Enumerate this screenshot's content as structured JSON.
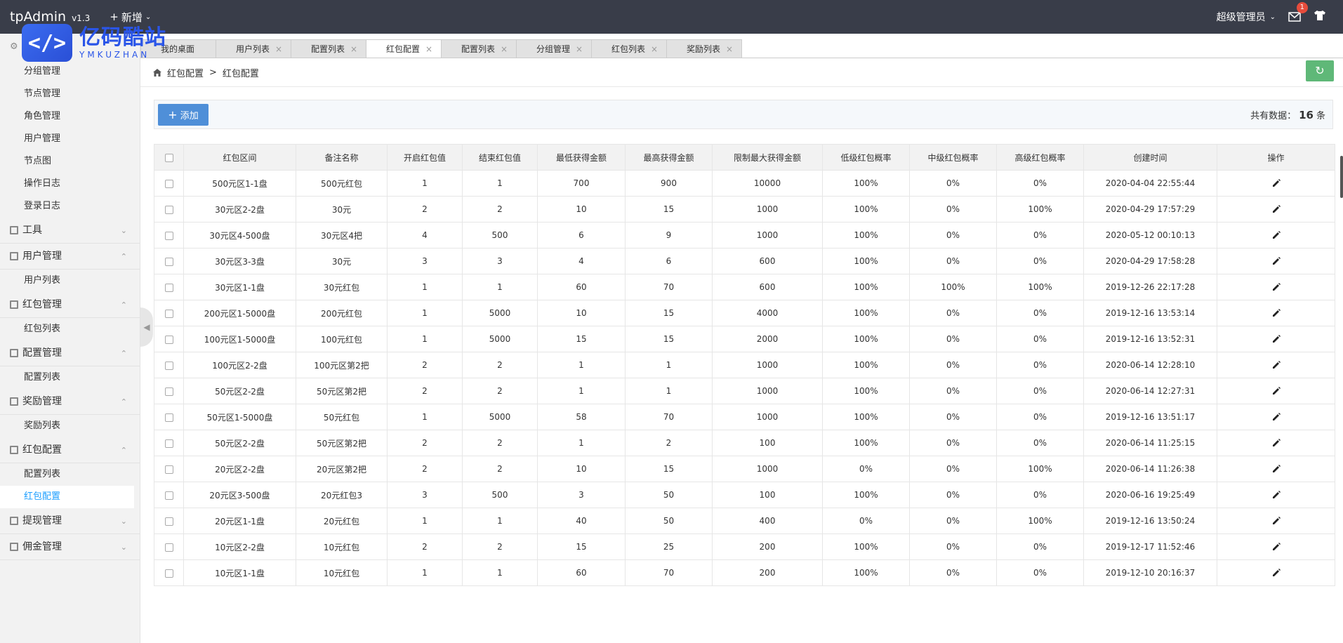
{
  "app": {
    "title": "tpAdmin",
    "version": "v1.3",
    "add_label": "新增"
  },
  "header": {
    "admin_label": "超级管理员",
    "mail_badge": "1"
  },
  "watermark": {
    "cn": "亿码酷站",
    "en": "YMKUZHAN"
  },
  "sidebar": {
    "items_top": [
      "分组管理",
      "节点管理",
      "角色管理",
      "用户管理",
      "节点图",
      "操作日志",
      "登录日志"
    ],
    "groups": [
      {
        "label": "工具",
        "expanded": false,
        "children": []
      },
      {
        "label": "用户管理",
        "expanded": true,
        "children": [
          "用户列表"
        ]
      },
      {
        "label": "红包管理",
        "expanded": true,
        "children": [
          "红包列表"
        ]
      },
      {
        "label": "配置管理",
        "expanded": true,
        "children": [
          "配置列表"
        ]
      },
      {
        "label": "奖励管理",
        "expanded": true,
        "children": [
          "奖励列表"
        ]
      },
      {
        "label": "红包配置",
        "expanded": true,
        "children": [
          "配置列表",
          "红包配置"
        ]
      },
      {
        "label": "提现管理",
        "expanded": false,
        "children": []
      },
      {
        "label": "佣金管理",
        "expanded": false,
        "children": []
      }
    ],
    "active_item": "红包配置"
  },
  "tabs": [
    {
      "label": "我的桌面",
      "active": false,
      "closable": false
    },
    {
      "label": "用户列表",
      "active": false,
      "closable": true
    },
    {
      "label": "配置列表",
      "active": false,
      "closable": true
    },
    {
      "label": "红包配置",
      "active": true,
      "closable": true
    },
    {
      "label": "配置列表",
      "active": false,
      "closable": true
    },
    {
      "label": "分组管理",
      "active": false,
      "closable": true
    },
    {
      "label": "红包列表",
      "active": false,
      "closable": true
    },
    {
      "label": "奖励列表",
      "active": false,
      "closable": true
    }
  ],
  "breadcrumb": {
    "parent": "红包配置",
    "separator": ">",
    "current": "红包配置"
  },
  "toolbar": {
    "add_label": "添加",
    "total_label": "共有数据：",
    "total_count": "16",
    "total_unit": "条"
  },
  "table": {
    "columns": [
      "红包区间",
      "备注名称",
      "开启红包值",
      "结束红包值",
      "最低获得金额",
      "最高获得金额",
      "限制最大获得金额",
      "低级红包概率",
      "中级红包概率",
      "高级红包概率",
      "创建时间",
      "操作"
    ],
    "rows": [
      [
        "500元区1-1盘",
        "500元红包",
        "1",
        "1",
        "700",
        "900",
        "10000",
        "100%",
        "0%",
        "0%",
        "2020-04-04 22:55:44"
      ],
      [
        "30元区2-2盘",
        "30元",
        "2",
        "2",
        "10",
        "15",
        "1000",
        "100%",
        "0%",
        "100%",
        "2020-04-29 17:57:29"
      ],
      [
        "30元区4-500盘",
        "30元区4把",
        "4",
        "500",
        "6",
        "9",
        "1000",
        "100%",
        "0%",
        "0%",
        "2020-05-12 00:10:13"
      ],
      [
        "30元区3-3盘",
        "30元",
        "3",
        "3",
        "4",
        "6",
        "600",
        "100%",
        "0%",
        "0%",
        "2020-04-29 17:58:28"
      ],
      [
        "30元区1-1盘",
        "30元红包",
        "1",
        "1",
        "60",
        "70",
        "600",
        "100%",
        "100%",
        "100%",
        "2019-12-26 22:17:28"
      ],
      [
        "200元区1-5000盘",
        "200元红包",
        "1",
        "5000",
        "10",
        "15",
        "4000",
        "100%",
        "0%",
        "0%",
        "2019-12-16 13:53:14"
      ],
      [
        "100元区1-5000盘",
        "100元红包",
        "1",
        "5000",
        "15",
        "15",
        "2000",
        "100%",
        "0%",
        "0%",
        "2019-12-16 13:52:31"
      ],
      [
        "100元区2-2盘",
        "100元区第2把",
        "2",
        "2",
        "1",
        "1",
        "1000",
        "100%",
        "0%",
        "0%",
        "2020-06-14 12:28:10"
      ],
      [
        "50元区2-2盘",
        "50元区第2把",
        "2",
        "2",
        "1",
        "1",
        "1000",
        "100%",
        "0%",
        "0%",
        "2020-06-14 12:27:31"
      ],
      [
        "50元区1-5000盘",
        "50元红包",
        "1",
        "5000",
        "58",
        "70",
        "1000",
        "100%",
        "0%",
        "0%",
        "2019-12-16 13:51:17"
      ],
      [
        "50元区2-2盘",
        "50元区第2把",
        "2",
        "2",
        "1",
        "2",
        "100",
        "100%",
        "0%",
        "0%",
        "2020-06-14 11:25:15"
      ],
      [
        "20元区2-2盘",
        "20元区第2把",
        "2",
        "2",
        "10",
        "15",
        "1000",
        "0%",
        "0%",
        "100%",
        "2020-06-14 11:26:38"
      ],
      [
        "20元区3-500盘",
        "20元红包3",
        "3",
        "500",
        "3",
        "50",
        "100",
        "100%",
        "0%",
        "0%",
        "2020-06-16 19:25:49"
      ],
      [
        "20元区1-1盘",
        "20元红包",
        "1",
        "1",
        "40",
        "50",
        "400",
        "0%",
        "0%",
        "100%",
        "2019-12-16 13:50:24"
      ],
      [
        "10元区2-2盘",
        "10元红包",
        "2",
        "2",
        "15",
        "25",
        "200",
        "100%",
        "0%",
        "0%",
        "2019-12-17 11:52:46"
      ],
      [
        "10元区1-1盘",
        "10元红包",
        "1",
        "1",
        "60",
        "70",
        "200",
        "100%",
        "0%",
        "0%",
        "2019-12-10 20:16:37"
      ]
    ]
  },
  "colors": {
    "topbar": "#393d49",
    "accent": "#1e9fff",
    "add_button": "#4f8fd8",
    "refresh_button": "#5fb878"
  }
}
